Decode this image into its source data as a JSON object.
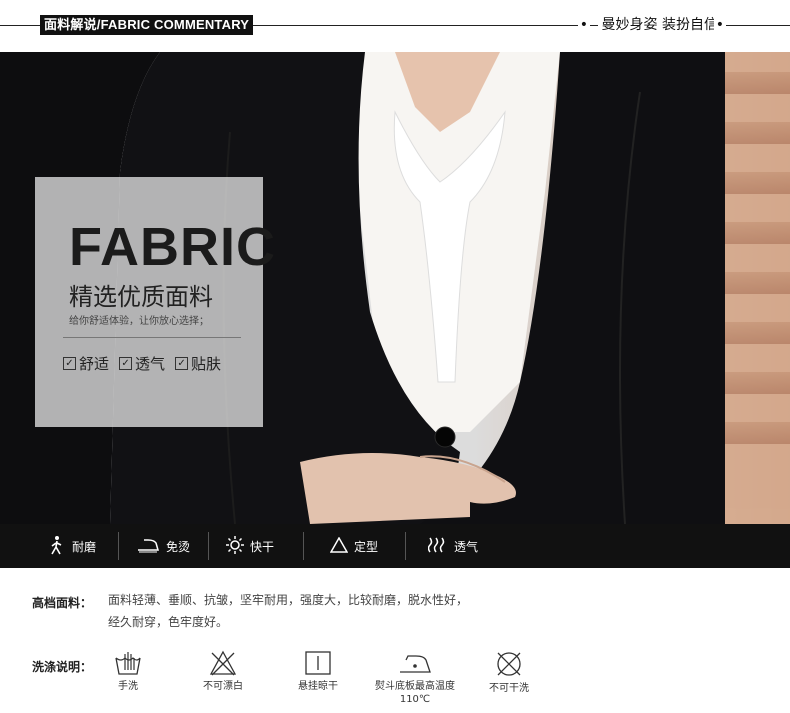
{
  "header": {
    "title": "面料解说/FABRIC COMMENTARY",
    "slogan": "曼妙身姿 装扮自信",
    "dot_left": "•",
    "dot_right": "•"
  },
  "panel": {
    "big": "FABRIC",
    "sub": "精选优质面料",
    "small": "给你舒适体验，让你放心选择；",
    "checks": [
      "舒适",
      "透气",
      "贴肤"
    ]
  },
  "features": [
    {
      "icon": "walking-person-icon",
      "label": "耐磨"
    },
    {
      "icon": "iron-icon",
      "label": "免烫"
    },
    {
      "icon": "sun-icon",
      "label": "快干"
    },
    {
      "icon": "triangle-icon",
      "label": "定型"
    },
    {
      "icon": "wave-icon",
      "label": "透气"
    }
  ],
  "fabric": {
    "label": "高档面料：",
    "line1": "面料轻薄、垂顺、抗皱，坚牢耐用，强度大，比较耐磨，脱水性好，",
    "line2": "经久耐穿，色牢度好。"
  },
  "washing": {
    "label": "洗涤说明：",
    "items": [
      {
        "icon": "hand-wash-icon",
        "caption": "手洗"
      },
      {
        "icon": "no-bleach-icon",
        "caption": "不可漂白"
      },
      {
        "icon": "hang-dry-icon",
        "caption": "悬挂晾干"
      },
      {
        "icon": "iron-temperature-icon",
        "caption": "熨斗底板最高温度110℃"
      },
      {
        "icon": "no-dry-clean-icon",
        "caption": "不可干洗"
      }
    ]
  },
  "colors": {
    "jacket": "#0d0d0f",
    "blouse": "#f7f5f2",
    "feature_bar": "#111111"
  }
}
